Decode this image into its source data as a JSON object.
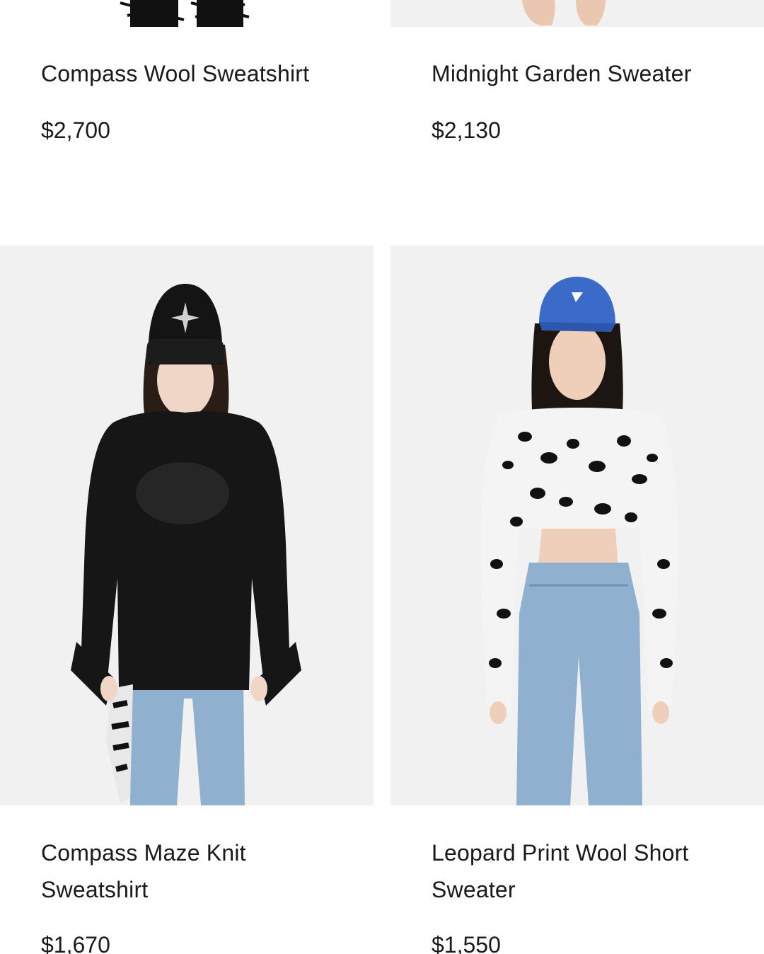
{
  "products": [
    {
      "name": "Compass Wool Sweatshirt",
      "price": "$2,700"
    },
    {
      "name": "Midnight Garden Sweater",
      "price": "$2,130"
    },
    {
      "name": "Compass Maze Knit Sweatshirt",
      "price": "$1,670"
    },
    {
      "name": "Leopard Print Wool Short Sweater",
      "price": "$1,550"
    }
  ],
  "colors": {
    "background": "#ffffff",
    "image_bg": "#f1f1f1",
    "text": "#1a1a1a"
  }
}
